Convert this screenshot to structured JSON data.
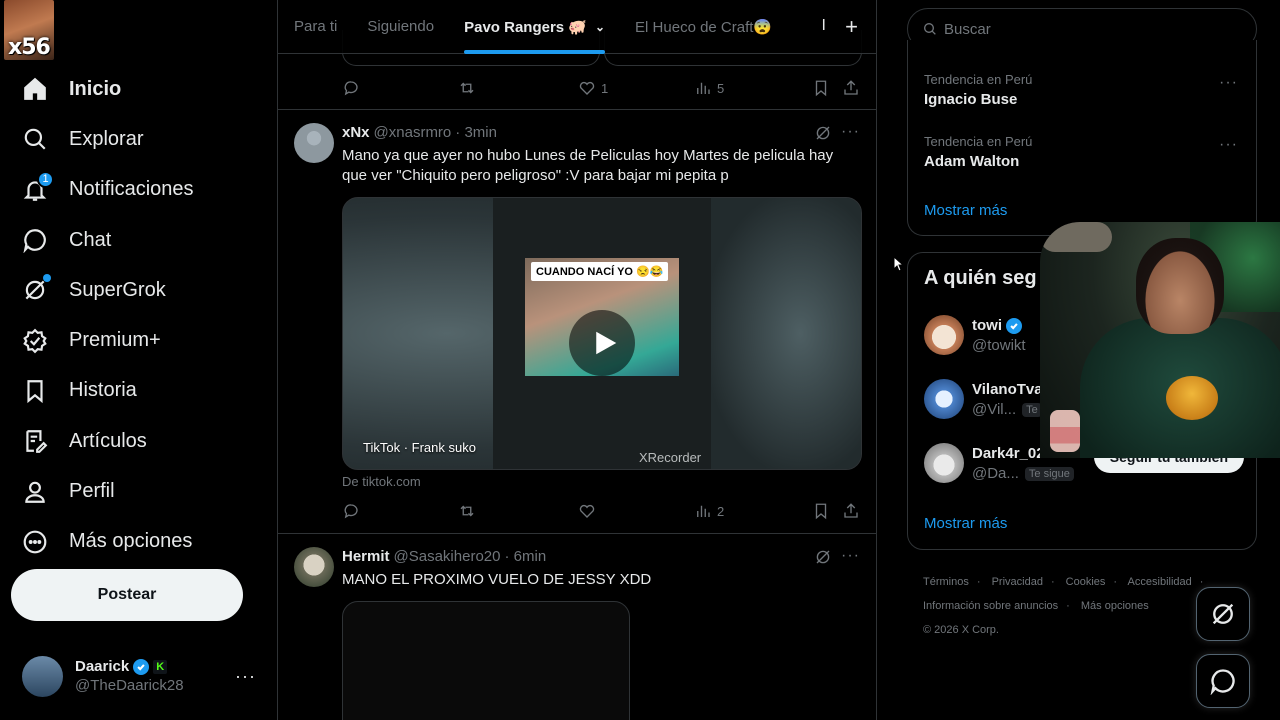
{
  "badge": {
    "text": "x56"
  },
  "nav": {
    "items": [
      {
        "label": "Inicio",
        "icon": "home-icon"
      },
      {
        "label": "Explorar",
        "icon": "search-icon"
      },
      {
        "label": "Notificaciones",
        "icon": "bell-icon",
        "count": "1"
      },
      {
        "label": "Chat",
        "icon": "chat-icon"
      },
      {
        "label": "SuperGrok",
        "icon": "grok-icon"
      },
      {
        "label": "Premium+",
        "icon": "verified-icon"
      },
      {
        "label": "Historia",
        "icon": "bookmark-icon"
      },
      {
        "label": "Artículos",
        "icon": "article-icon"
      },
      {
        "label": "Perfil",
        "icon": "person-icon"
      },
      {
        "label": "Más opciones",
        "icon": "more-circle-icon"
      }
    ],
    "post_label": "Postear"
  },
  "account": {
    "name": "Daarick",
    "handle": "@TheDaarick28",
    "k": "K",
    "more": "···"
  },
  "tabs": {
    "items": [
      {
        "label": "Para ti"
      },
      {
        "label": "Siguiendo"
      },
      {
        "label": "Pavo Rangers 🐖"
      },
      {
        "label": "El Hueco de Craft😨"
      }
    ],
    "sep": "I",
    "add": "+"
  },
  "tweets": [
    {
      "likes": "1",
      "views": "5"
    },
    {
      "name": "xNx",
      "handle": "@xnasrmro",
      "time": "· 3min",
      "text": "Mano ya que ayer no hubo Lunes de Peliculas hoy Martes de pelicula hay que ver \"Chiquito pero peligroso\" :V para bajar mi pepita p",
      "media_caption": "CUANDO NACÍ YO 😒😂",
      "media_source": "TikTok · Frank suko",
      "watermark": "XRecorder",
      "from": "De tiktok.com",
      "views": "2"
    },
    {
      "name": "Hermit",
      "handle": "@Sasakihero20",
      "time": "· 6min",
      "text": "MANO EL PROXIMO VUELO DE JESSY XDD"
    }
  ],
  "right": {
    "search_placeholder": "Buscar",
    "trends": [
      {
        "meta": "Tendencia en Perú",
        "title": "Ignacio Buse"
      },
      {
        "meta": "Tendencia en Perú",
        "title": "Adam Walton"
      }
    ],
    "show_more": "Mostrar más",
    "who_to_follow_title": "A quién seg",
    "follows": [
      {
        "name": "towi",
        "handle": "@towikt",
        "verified": true
      },
      {
        "name": "VilanoTva",
        "handle": "@Vil...",
        "follows_you": "Te"
      },
      {
        "name": "Dark4r_02",
        "handle": "@Da...",
        "follows_you": "Te sigue",
        "button": "Seguir tú también"
      }
    ],
    "show_more_2": "Mostrar más",
    "footer": {
      "links": [
        "Términos",
        "Privacidad",
        "Cookies",
        "Accesibilidad",
        "Información sobre anuncios",
        "Más opciones"
      ],
      "copyright": "© 2026 X Corp."
    }
  }
}
